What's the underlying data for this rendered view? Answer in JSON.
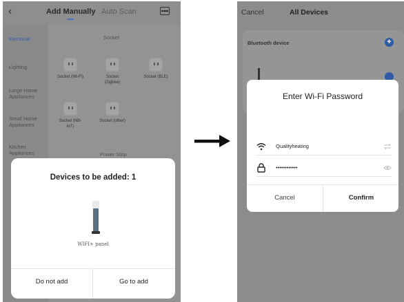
{
  "left_screen": {
    "header": {
      "tab_add_manually": "Add Manually",
      "tab_auto_scan": "Auto Scan"
    },
    "sidebar": {
      "items": [
        "Electrical",
        "Lighting",
        "Large Home Appliances",
        "Small Home Appliances",
        "Kitchen Appliances"
      ]
    },
    "content": {
      "socket_section_title": "Socket",
      "power_strip_section_title": "Power Strip",
      "devices": [
        {
          "name": "Socket (Wi-Fi)"
        },
        {
          "name": "Socket (Zigbee)"
        },
        {
          "name": "Socket (BLE)"
        },
        {
          "name": "Socket (NB-IoT)"
        },
        {
          "name": "Socket (other)"
        }
      ]
    },
    "modal": {
      "title": "Devices to be added: 1",
      "device_label": "WIFI+ panel",
      "do_not_add": "Do not add",
      "go_to_add": "Go to add"
    }
  },
  "right_screen": {
    "header": {
      "cancel": "Cancel",
      "title": "All Devices"
    },
    "bluetooth_label": "Bluetooth device",
    "modal": {
      "title": "Enter Wi-Fi Password",
      "ssid": "Qualityheating",
      "password": "••••••••••••",
      "cancel": "Cancel",
      "confirm": "Confirm"
    }
  },
  "colors": {
    "accent_blue": "#2e5aa6",
    "overlay_gray": "#8e8e8e"
  }
}
